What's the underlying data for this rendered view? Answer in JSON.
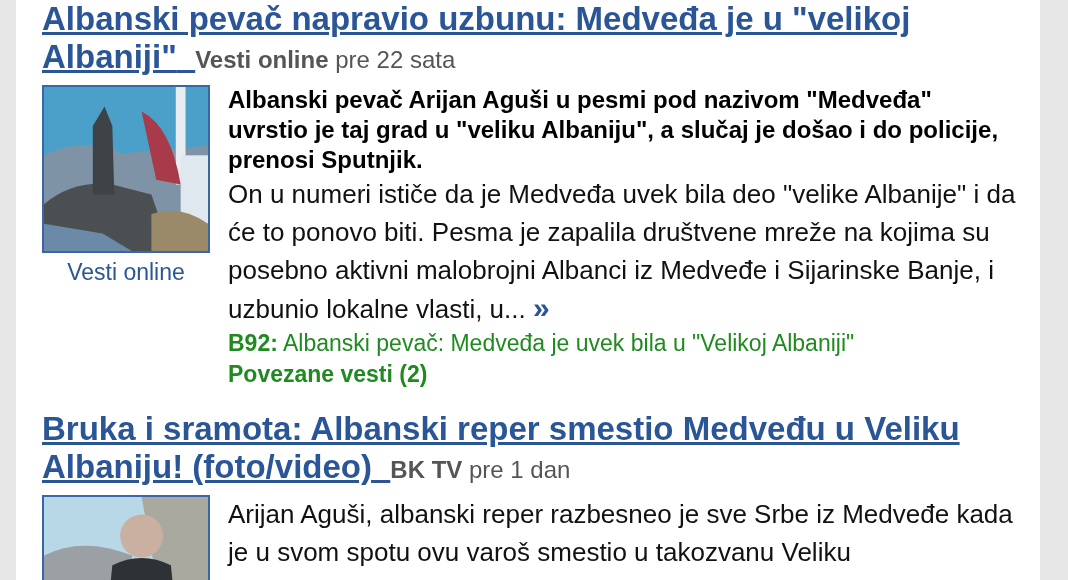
{
  "articles": [
    {
      "title_lines": [
        "Albanski pevač napravio uzbunu: Medveđa je u \"velikoj",
        "Albaniji\""
      ],
      "source": "Vesti online",
      "time": "pre 22 sata",
      "image_caption": "Vesti online",
      "lead": "Albanski pevač Arijan Aguši u pesmi pod nazivom \"Medveđa\" uvrstio je taj grad u \"veliku Albaniju\", a slučaj je došao i do policije, prenosi Sputnjik.",
      "body": "On u numeri ističe da je Medveđa uvek bila deo \"velike Albanije\" i da će to ponovo biti. Pesma je zapalila društvene mreže na kojima su posebno aktivni malobrojni Albanci iz Medveđe i Sijarinske Banje, i uzbunio lokalne vlasti, u...",
      "more": "»",
      "related": {
        "source": "B92:",
        "title": "Albanski pevač: Medveđa je uvek bila u \"Velikoj Albaniji\""
      },
      "related_count": "Povezane vesti (2)"
    },
    {
      "title_lines": [
        "Bruka i sramota: Albanski reper smestio Medveđu u Veliku",
        "Albaniju! (foto/video)"
      ],
      "source": "BK TV",
      "time": "pre 1 dan",
      "body": "Arijan Aguši, albanski reper razbesneo je sve Srbe iz Medveđe kada je u svom spotu ovu varoš smestio u takozvanu Veliku"
    }
  ]
}
